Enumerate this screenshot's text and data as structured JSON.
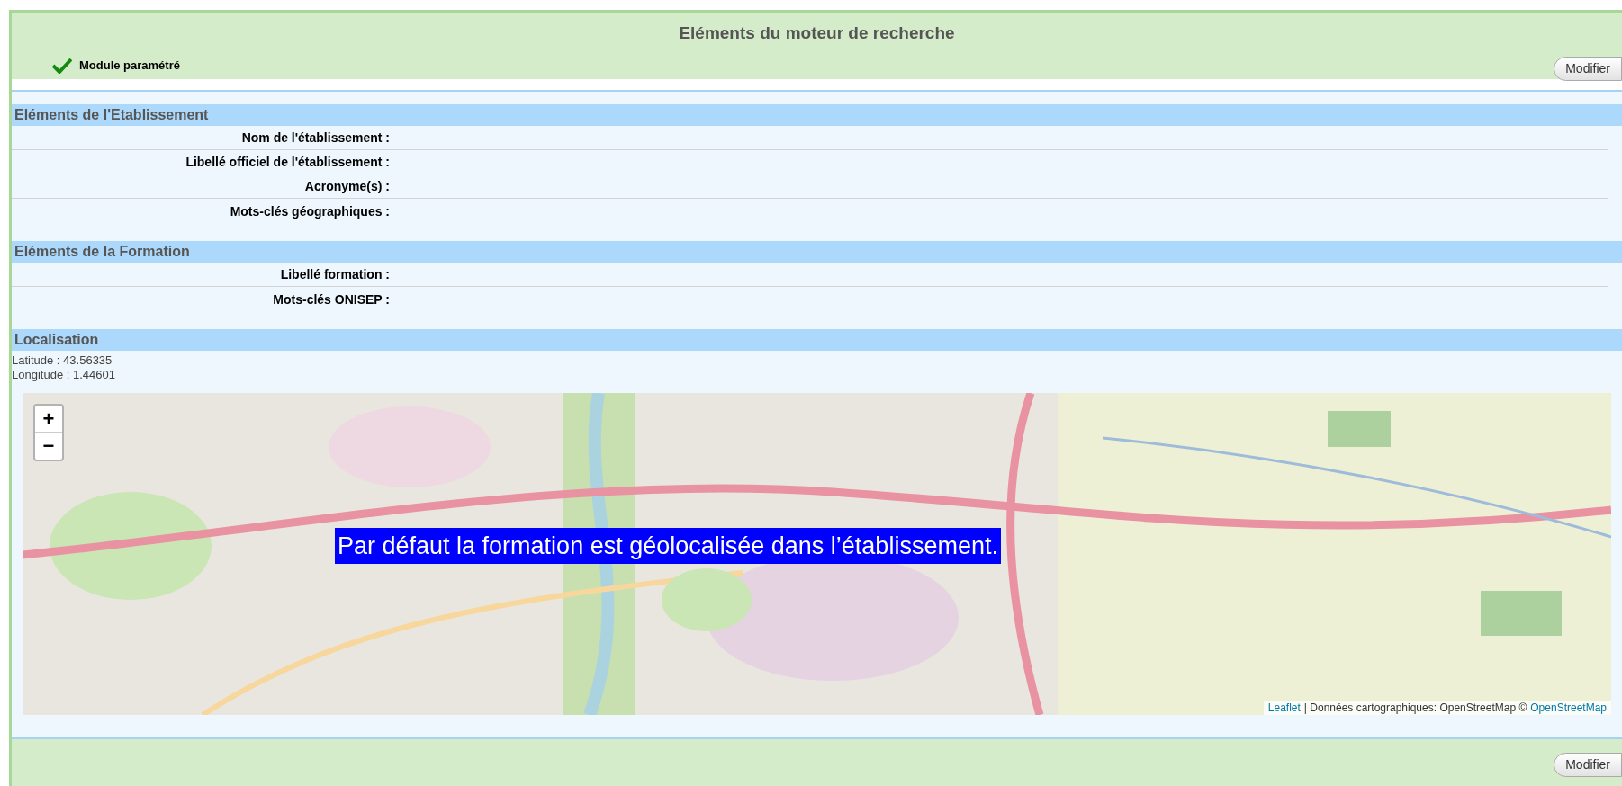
{
  "panel": {
    "title": "Eléments du moteur de recherche",
    "status": {
      "label": "Module paramétré",
      "checked": true
    },
    "buttons": [
      "Modifier",
      "Modifier"
    ]
  },
  "sections": [
    {
      "title": "Eléments de l'Etablissement",
      "fields": [
        {
          "label": "Nom de l'établissement :"
        },
        {
          "label": "Libellé officiel de l'établissement :"
        },
        {
          "label": "Acronyme(s) :"
        },
        {
          "label": "Mots-clés géographiques :"
        }
      ]
    },
    {
      "title": "Eléments de la Formation",
      "fields": [
        {
          "label": "Libellé formation :"
        },
        {
          "label": "Mots-clés ONISEP :"
        }
      ]
    },
    {
      "title": "Localisation",
      "lines": [
        "Latitude : 43.56335",
        "Longitude : 1.44601"
      ]
    }
  ],
  "map": {
    "kind": "picture",
    "zoom": [
      "+",
      "−"
    ],
    "attribution": {
      "link": "Leaflet",
      "text": "| Données cartographiques: OpenStreetMap ©",
      "source": "OpenStreetMap"
    }
  },
  "annotation": "Par défaut la formation est géolocalisée dans l’établissement."
}
